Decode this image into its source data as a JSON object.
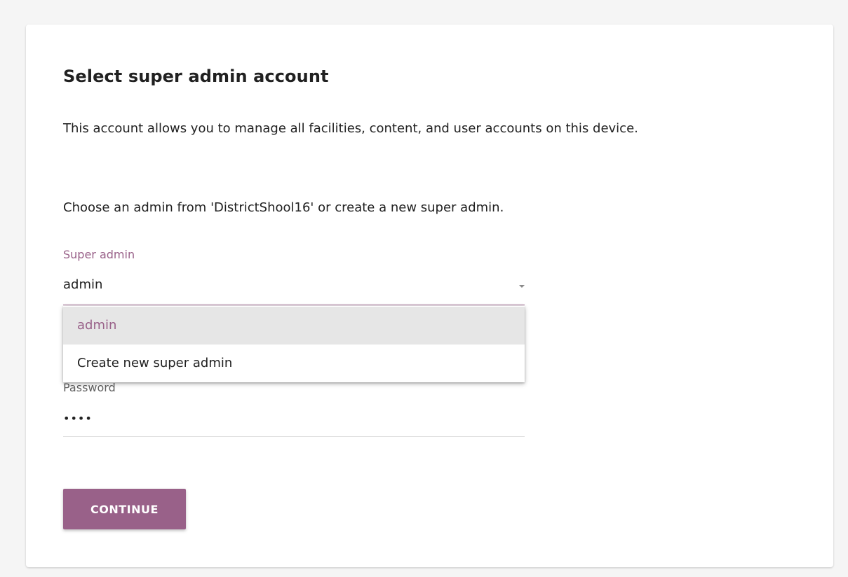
{
  "page": {
    "title": "Select super admin account",
    "description": "This account allows you to manage all facilities, content, and user accounts on this device.",
    "instruction": "Choose an admin from 'DistrictShool16' or create a new super admin."
  },
  "super_admin_select": {
    "label": "Super admin",
    "value": "admin",
    "options": [
      "admin",
      "Create new super admin"
    ]
  },
  "password_field": {
    "label": "Password",
    "value": "••••"
  },
  "continue_button": {
    "label": "CONTINUE"
  },
  "colors": {
    "accent": "#996189",
    "background": "#f5f5f5",
    "card": "#ffffff",
    "option_highlight": "#e6e6e6"
  },
  "icons": {
    "select_arrow": "dropdown-arrow-icon"
  }
}
